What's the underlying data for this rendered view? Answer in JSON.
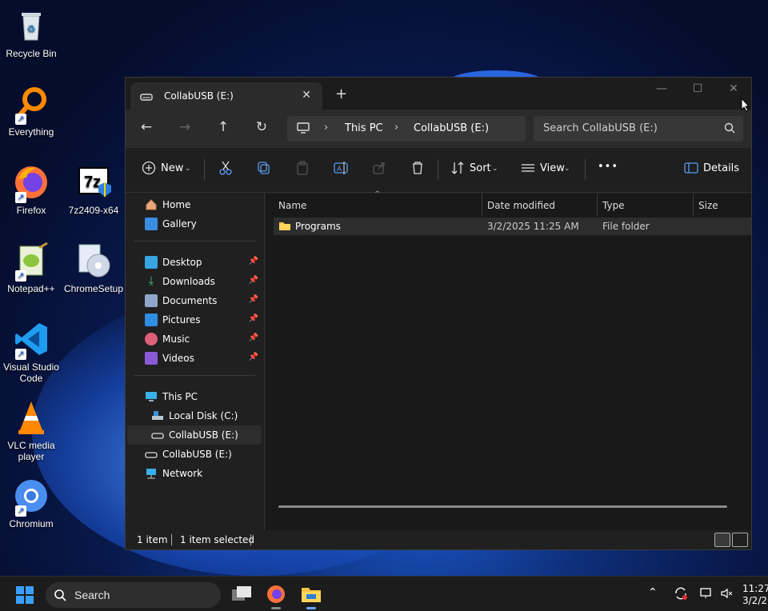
{
  "desktop": {
    "icons": [
      {
        "label": "Recycle Bin",
        "icon": "recycle-bin-icon"
      },
      {
        "label": "Everything",
        "icon": "everything-search-icon"
      },
      {
        "label": "Firefox",
        "icon": "firefox-icon"
      },
      {
        "label": "7z2409-x64",
        "icon": "7zip-installer-icon"
      },
      {
        "label": "Notepad++",
        "icon": "notepad-plus-plus-icon"
      },
      {
        "label": "ChromeSetup",
        "icon": "chrome-setup-icon"
      },
      {
        "label": "Visual Studio Code",
        "icon": "vscode-icon"
      },
      {
        "label": "VLC media player",
        "icon": "vlc-icon"
      },
      {
        "label": "Chromium",
        "icon": "chromium-icon"
      }
    ]
  },
  "explorer": {
    "tab_title": "CollabUSB (E:)",
    "breadcrumb": [
      "This PC",
      "CollabUSB (E:)"
    ],
    "search_placeholder": "Search CollabUSB (E:)",
    "toolbar": {
      "new_label": "New",
      "sort_label": "Sort",
      "view_label": "View",
      "more_label": "•••",
      "details_label": "Details"
    },
    "sidebar": {
      "top": [
        {
          "label": "Home",
          "icon": "home-icon"
        },
        {
          "label": "Gallery",
          "icon": "gallery-icon"
        }
      ],
      "quick_access": [
        {
          "label": "Desktop",
          "icon": "desktop-folder-icon"
        },
        {
          "label": "Downloads",
          "icon": "downloads-icon"
        },
        {
          "label": "Documents",
          "icon": "documents-icon"
        },
        {
          "label": "Pictures",
          "icon": "pictures-icon"
        },
        {
          "label": "Music",
          "icon": "music-icon"
        },
        {
          "label": "Videos",
          "icon": "videos-icon"
        }
      ],
      "devices": [
        {
          "label": "This PC",
          "icon": "this-pc-icon"
        },
        {
          "label": "Local Disk (C:)",
          "icon": "local-disk-icon"
        },
        {
          "label": "CollabUSB (E:)",
          "icon": "usb-drive-icon",
          "selected": true
        },
        {
          "label": "CollabUSB (E:)",
          "icon": "usb-drive-icon"
        },
        {
          "label": "Network",
          "icon": "network-icon"
        }
      ]
    },
    "columns": [
      "Name",
      "Date modified",
      "Type",
      "Size"
    ],
    "files": [
      {
        "name": "Programs",
        "date": "3/2/2025 11:25 AM",
        "type": "File folder",
        "size": ""
      }
    ],
    "status": {
      "count": "1 item",
      "selected": "1 item selected"
    }
  },
  "taskbar": {
    "search_label": "Search",
    "clock_time": "11:27",
    "clock_date": "3/2/2"
  }
}
